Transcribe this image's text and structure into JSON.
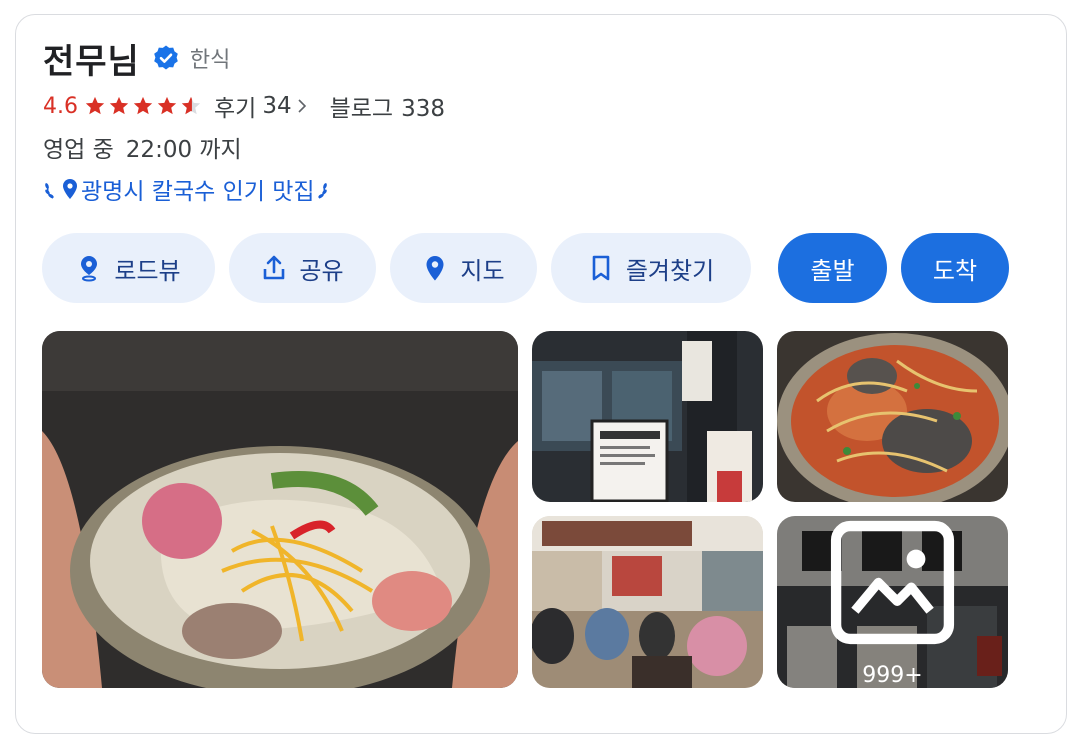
{
  "place": {
    "name": "전무님",
    "category": "한식",
    "rating": "4.6",
    "rating_value": 4.6,
    "reviews_label": "후기",
    "reviews_count": "34",
    "blog_label": "블로그",
    "blog_count": "338",
    "status": "영업 중",
    "hours": "22:00 까지",
    "tag": "광명시 칼국수 인기 맛집"
  },
  "actions": {
    "roadview": "로드뷰",
    "share": "공유",
    "map": "지도",
    "bookmark": "즐겨찾기",
    "depart": "출발",
    "arrive": "도착"
  },
  "photos": {
    "more_count": "999+"
  },
  "colors": {
    "rating_red": "#d93025",
    "accent_blue": "#1c6fe0",
    "chip_bg": "#e9f0fb",
    "verified_blue": "#1a73e8"
  },
  "icons": [
    "verified-icon",
    "star-icon",
    "chevron-right-icon",
    "laurel-icon",
    "pin-icon",
    "roadview-icon",
    "share-icon",
    "map-pin-icon",
    "bookmark-icon",
    "gallery-icon"
  ]
}
